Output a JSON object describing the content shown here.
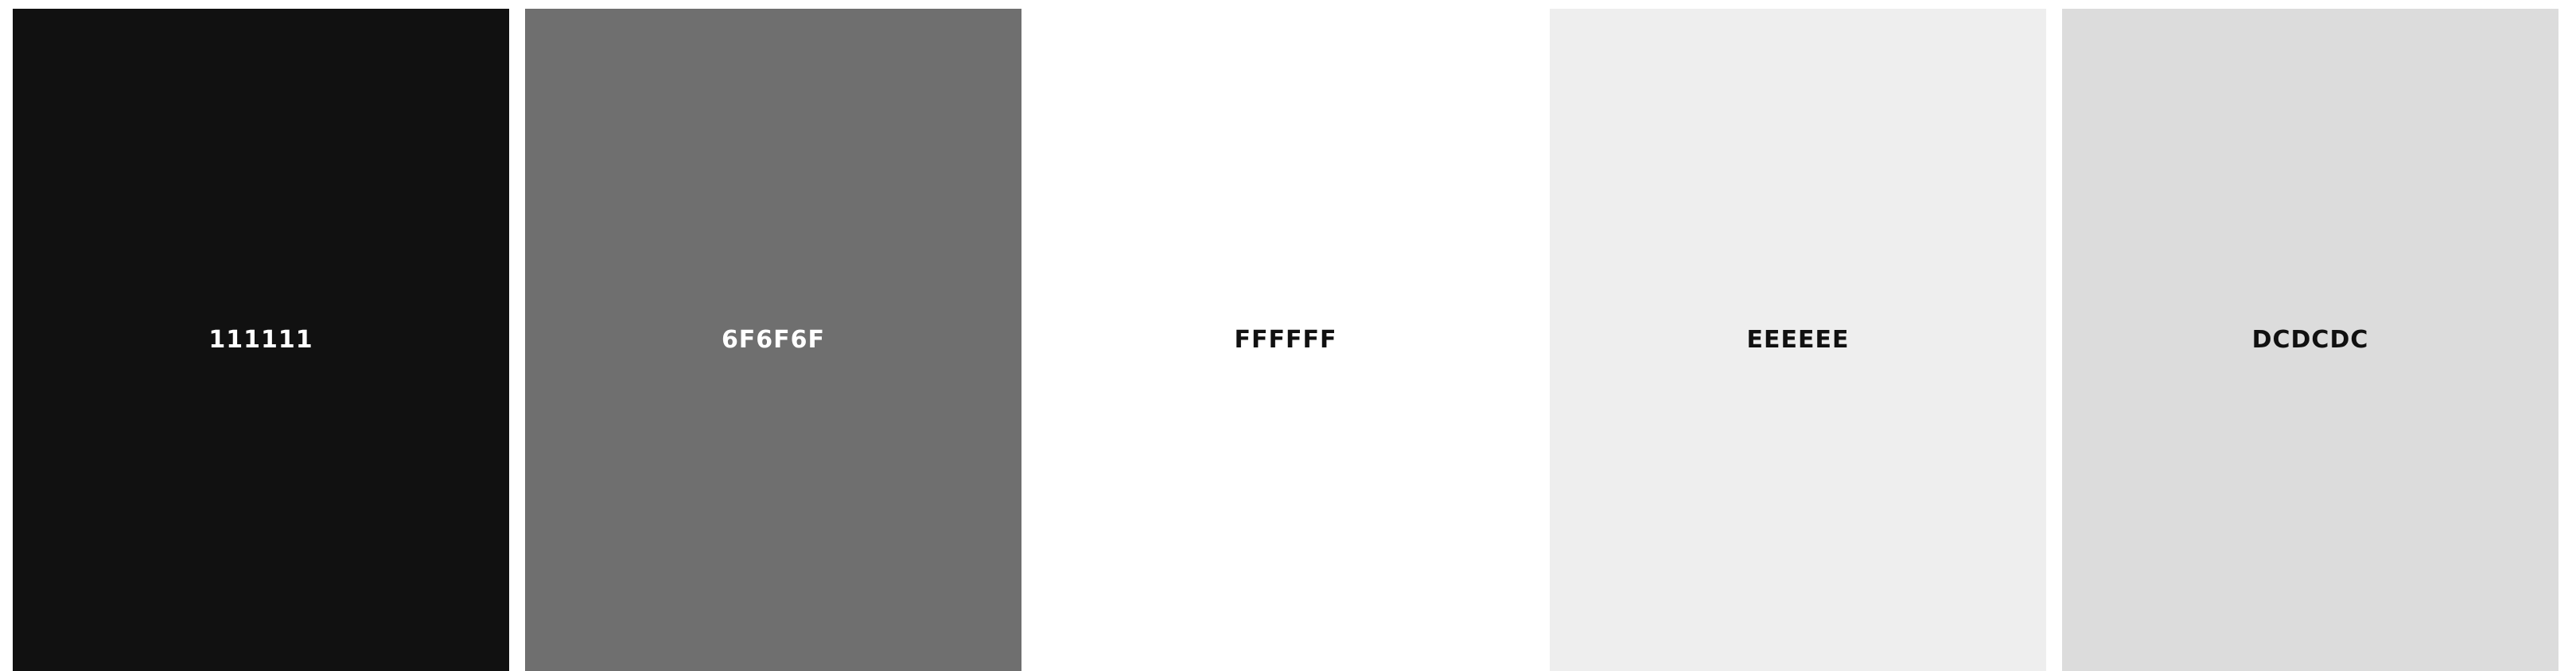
{
  "swatches": [
    {
      "hex": "111111",
      "color": "#111111",
      "text_color": "#ffffff"
    },
    {
      "hex": "6F6F6F",
      "color": "#6F6F6F",
      "text_color": "#ffffff"
    },
    {
      "hex": "FFFFFF",
      "color": "#FFFFFF",
      "text_color": "#111111"
    },
    {
      "hex": "EEEEEE",
      "color": "#EEEEEE",
      "text_color": "#111111"
    },
    {
      "hex": "DCDCDC",
      "color": "#DCDCDC",
      "text_color": "#111111"
    }
  ]
}
